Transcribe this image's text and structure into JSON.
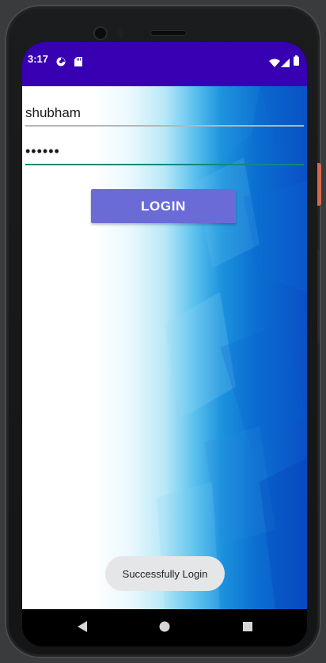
{
  "status_bar": {
    "time": "3:17",
    "icons": [
      "notification-icon",
      "sd-card-icon",
      "wifi-icon",
      "signal-icon",
      "battery-icon"
    ]
  },
  "form": {
    "username_value": "shubham",
    "password_value": "••••••",
    "login_label": "LOGIN"
  },
  "toast": {
    "message": "Successfully Login"
  },
  "nav_bar": {
    "icons": [
      "back-icon",
      "home-icon",
      "recents-icon"
    ]
  },
  "colors": {
    "status_bar": "#3700b3",
    "login_button": "#6b6bd8",
    "active_underline": "#0f8a7a",
    "toast_background": "#e4e6e8"
  }
}
